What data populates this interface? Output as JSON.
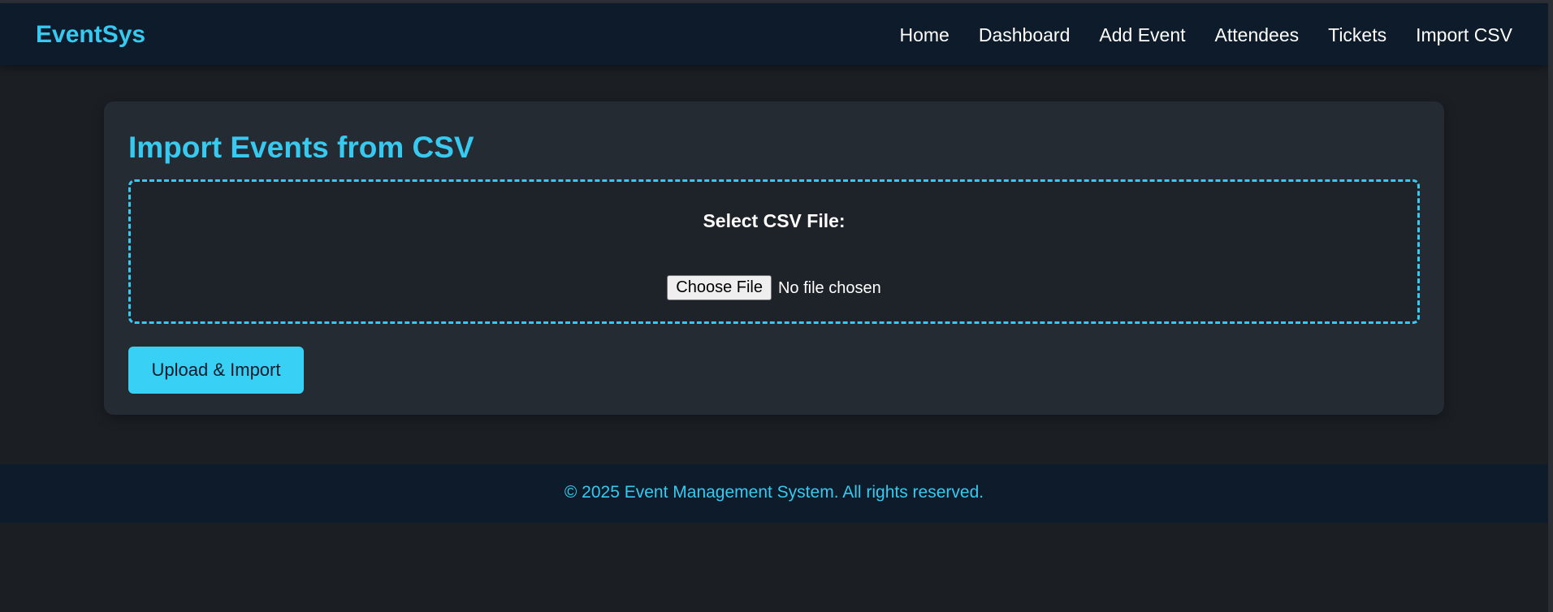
{
  "nav": {
    "brand": "EventSys",
    "links": [
      "Home",
      "Dashboard",
      "Add Event",
      "Attendees",
      "Tickets",
      "Import CSV"
    ]
  },
  "main": {
    "title": "Import Events from CSV",
    "file_label": "Select CSV File:",
    "choose_file_label": "Choose File",
    "file_status": "No file chosen",
    "upload_button": "Upload & Import"
  },
  "footer": {
    "text": "© 2025 Event Management System. All rights reserved."
  },
  "colors": {
    "accent": "#38c9f0",
    "navbar_bg": "#0d1b2a",
    "page_bg": "#1b1f24",
    "card_bg": "#252b33"
  }
}
